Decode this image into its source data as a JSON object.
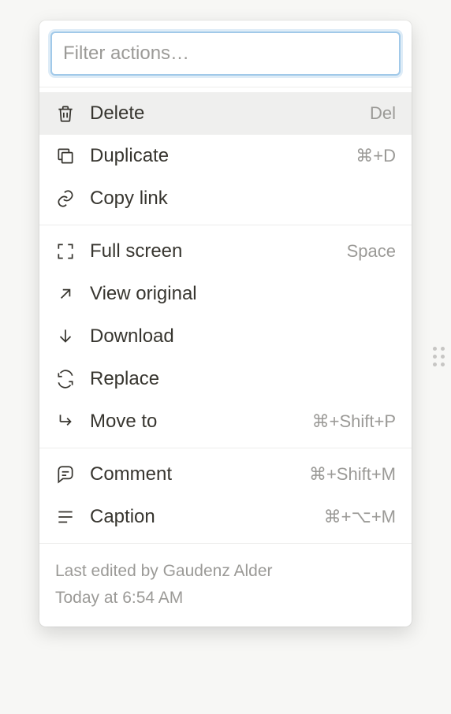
{
  "filter": {
    "placeholder": "Filter actions…",
    "value": ""
  },
  "sections": [
    {
      "items": [
        {
          "key": "delete",
          "label": "Delete",
          "shortcut": "Del"
        },
        {
          "key": "duplicate",
          "label": "Duplicate",
          "shortcut": "⌘+D"
        },
        {
          "key": "copylink",
          "label": "Copy link",
          "shortcut": ""
        }
      ]
    },
    {
      "items": [
        {
          "key": "fullscreen",
          "label": "Full screen",
          "shortcut": "Space"
        },
        {
          "key": "vieworiginal",
          "label": "View original",
          "shortcut": ""
        },
        {
          "key": "download",
          "label": "Download",
          "shortcut": ""
        },
        {
          "key": "replace",
          "label": "Replace",
          "shortcut": ""
        },
        {
          "key": "moveto",
          "label": "Move to",
          "shortcut": "⌘+Shift+P"
        }
      ]
    },
    {
      "items": [
        {
          "key": "comment",
          "label": "Comment",
          "shortcut": "⌘+Shift+M"
        },
        {
          "key": "caption",
          "label": "Caption",
          "shortcut": "⌘+⌥+M"
        }
      ]
    }
  ],
  "footer": {
    "editedBy": "Last edited by Gaudenz Alder",
    "editedAt": "Today at 6:54 AM"
  }
}
